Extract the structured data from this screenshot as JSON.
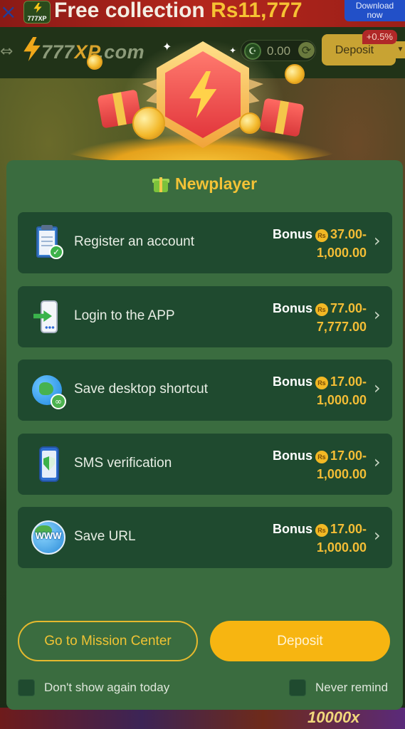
{
  "promo_banner": {
    "close_glyph": "×",
    "app_logo_text": "777XP",
    "title_prefix": "Free collection",
    "title_amount": "Rs11,777",
    "download_label_line1": "Download",
    "download_label_line2": "now"
  },
  "header": {
    "brand_prefix": "777",
    "brand_xp": "XP",
    "brand_suffix": ".com",
    "currency_symbol": "☪",
    "balance": "0.00",
    "deposit_label": "Deposit",
    "deposit_badge": "+0.5%"
  },
  "background": {
    "bottom_multiplier": "10000x"
  },
  "modal": {
    "title": "Newplayer",
    "tasks": [
      {
        "icon": "clipboard-check-icon",
        "label": "Register an account",
        "bonus_label": "Bonus",
        "currency_badge": "Rs",
        "amount_line1": "37.00-",
        "amount_line2": "1,000.00"
      },
      {
        "icon": "phone-login-icon",
        "label": "Login to the APP",
        "bonus_label": "Bonus",
        "currency_badge": "Rs",
        "amount_line1": "77.00-",
        "amount_line2": "7,777.00"
      },
      {
        "icon": "globe-link-icon",
        "label": "Save desktop shortcut",
        "bonus_label": "Bonus",
        "currency_badge": "Rs",
        "amount_line1": "17.00-",
        "amount_line2": "1,000.00"
      },
      {
        "icon": "phone-shield-icon",
        "label": "SMS verification",
        "bonus_label": "Bonus",
        "currency_badge": "Rs",
        "amount_line1": "17.00-",
        "amount_line2": "1,000.00"
      },
      {
        "icon": "www-globe-icon",
        "label": "Save URL",
        "bonus_label": "Bonus",
        "currency_badge": "Rs",
        "amount_line1": "17.00-",
        "amount_line2": "1,000.00"
      }
    ],
    "www_text": "WWW",
    "mission_button": "Go to Mission Center",
    "deposit_button": "Deposit",
    "checkbox_today": "Don't show again today",
    "checkbox_never": "Never remind"
  },
  "colors": {
    "accent_gold": "#f3bd35",
    "modal_bg": "#3a6c3f",
    "task_bg": "#1f4a2f",
    "deposit_button": "#f7b511"
  }
}
